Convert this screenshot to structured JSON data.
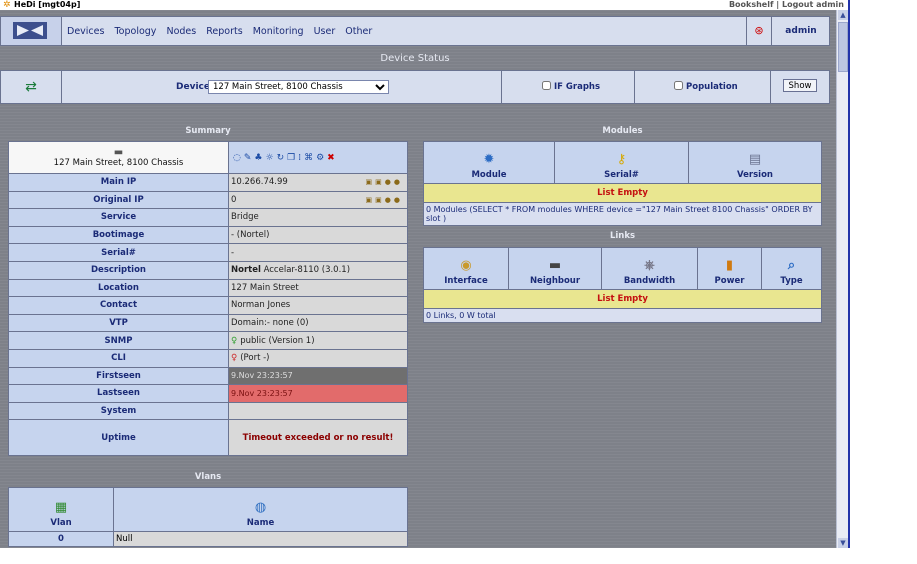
{
  "titlebar": {
    "title": "HeDi [mgt04p]",
    "links": [
      "Bookshelf",
      "Logout admin"
    ],
    "sep": "|"
  },
  "menu": {
    "items": [
      "Devices",
      "Topology",
      "Nodes",
      "Reports",
      "Monitoring",
      "User",
      "Other"
    ],
    "user": "admin"
  },
  "page_title": "Device Status",
  "device_bar": {
    "label": "Device",
    "selected": "127 Main Street, 8100 Chassis",
    "if_graphs": "IF Graphs",
    "population": "Population",
    "show_button": "Show"
  },
  "summary": {
    "header": "Summary",
    "device_name": "127 Main Street, 8100 Chassis",
    "rows": [
      {
        "label": "Main IP",
        "value": "10.266.74.99"
      },
      {
        "label": "Original IP",
        "value": "0"
      },
      {
        "label": "Service",
        "value": "Bridge"
      },
      {
        "label": "Bootimage",
        "value": "- (Nortel)"
      },
      {
        "label": "Serial#",
        "value": "-"
      },
      {
        "label": "Description",
        "value_bold": "Nortel",
        "value": "Accelar-8110 (3.0.1)"
      },
      {
        "label": "Location",
        "value": "127 Main Street"
      },
      {
        "label": "Contact",
        "value": "Norman Jones"
      },
      {
        "label": "VTP",
        "value": "Domain:- none (0)"
      },
      {
        "label": "SNMP",
        "value": "public (Version 1)"
      },
      {
        "label": "CLI",
        "value": "(Port -)"
      },
      {
        "label": "Firstseen",
        "value": "9.Nov 23:23:57"
      },
      {
        "label": "Lastseen",
        "value": "9.Nov 23:23:57"
      },
      {
        "label": "System",
        "value": ""
      },
      {
        "label": "Uptime",
        "value": "Timeout exceeded or no result!"
      }
    ]
  },
  "vlans": {
    "header": "Vlans",
    "columns": [
      "Vlan",
      "Name"
    ],
    "rows": [
      {
        "vlan": "0",
        "name": "Null"
      }
    ]
  },
  "modules": {
    "header": "Modules",
    "columns": [
      "Module",
      "Serial#",
      "Version"
    ],
    "empty": "List Empty",
    "note": "0 Modules (SELECT * FROM modules WHERE device =\"127 Main Street 8100 Chassis\" ORDER BY slot )"
  },
  "links": {
    "header": "Links",
    "columns": [
      "Interface",
      "Neighbour",
      "Bandwidth",
      "Power",
      "Type"
    ],
    "empty": "List Empty",
    "note": "0 Links, 0 W total"
  }
}
